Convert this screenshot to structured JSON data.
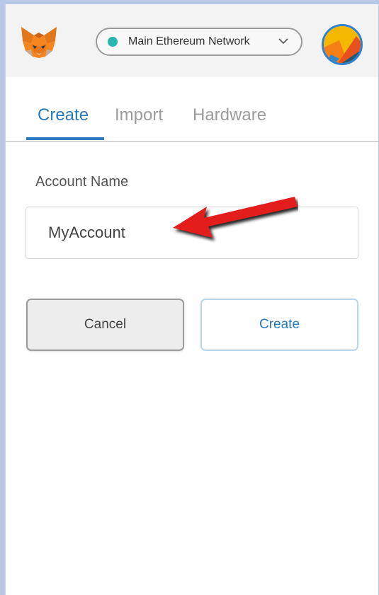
{
  "header": {
    "network": {
      "label": "Main Ethereum Network",
      "status_color": "#29b6af",
      "icon": "chevron-down-icon"
    },
    "logo_icon": "metamask-fox-icon",
    "avatar_icon": "account-identicon"
  },
  "tabs": [
    {
      "label": "Create",
      "active": true
    },
    {
      "label": "Import",
      "active": false
    },
    {
      "label": "Hardware",
      "active": false
    }
  ],
  "form": {
    "account_name_label": "Account Name",
    "account_name_value": "MyAccount"
  },
  "buttons": {
    "cancel_label": "Cancel",
    "create_label": "Create"
  },
  "annotation": {
    "icon": "red-arrow-icon",
    "color": "#e31b1b"
  },
  "colors": {
    "accent": "#2a79c0",
    "header_bg": "#f3f3f3",
    "backdrop": "#b9c8e6"
  }
}
